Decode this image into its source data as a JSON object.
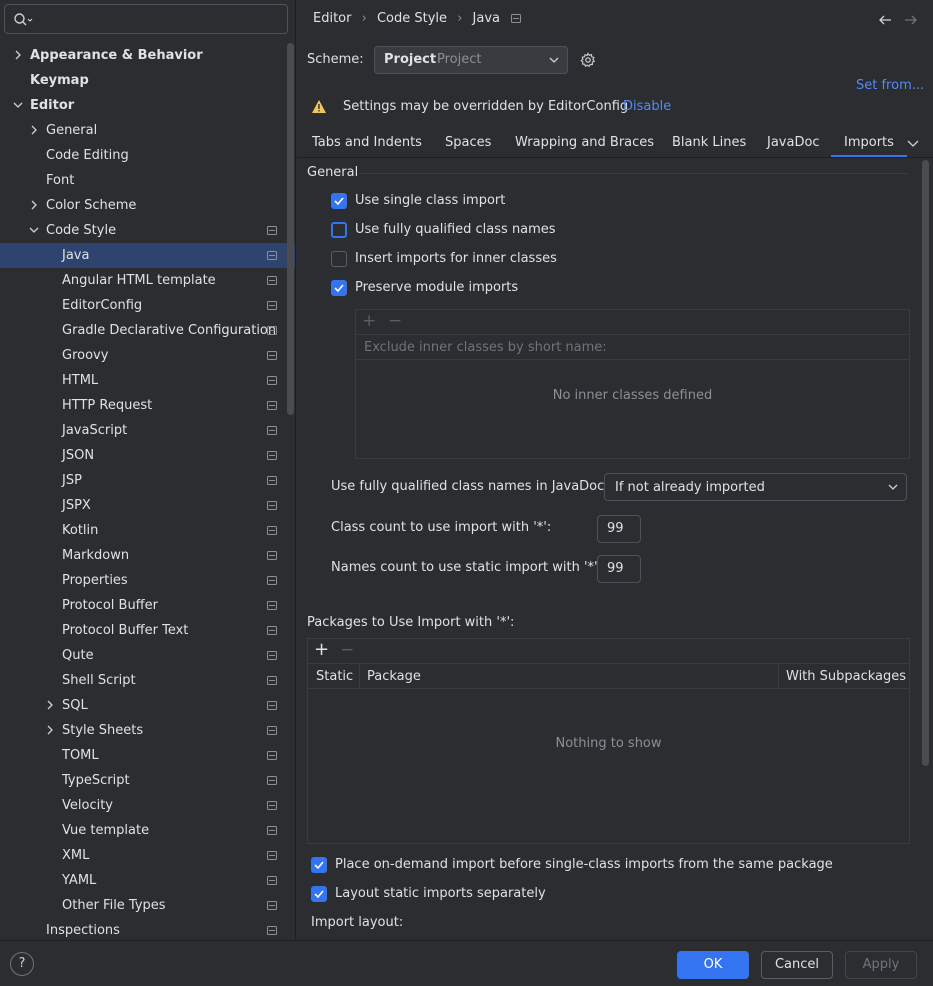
{
  "sidebar": {
    "search": {
      "value": "",
      "placeholder": ""
    },
    "items": [
      {
        "label": "Appearance & Behavior",
        "level": 0,
        "expandable": true,
        "expanded": false,
        "bold": true
      },
      {
        "label": "Keymap",
        "level": 0,
        "expandable": false,
        "bold": true
      },
      {
        "label": "Editor",
        "level": 0,
        "expandable": true,
        "expanded": true,
        "bold": true
      },
      {
        "label": "General",
        "level": 1,
        "expandable": true,
        "expanded": false
      },
      {
        "label": "Code Editing",
        "level": 1,
        "expandable": false
      },
      {
        "label": "Font",
        "level": 1,
        "expandable": false
      },
      {
        "label": "Color Scheme",
        "level": 1,
        "expandable": true,
        "expanded": false
      },
      {
        "label": "Code Style",
        "level": 1,
        "expandable": true,
        "expanded": true,
        "project": true
      },
      {
        "label": "Java",
        "level": 2,
        "selected": true,
        "project": true
      },
      {
        "label": "Angular HTML template",
        "level": 2,
        "project": true
      },
      {
        "label": "EditorConfig",
        "level": 2,
        "project": true
      },
      {
        "label": "Gradle Declarative Configuration",
        "level": 2,
        "project": true
      },
      {
        "label": "Groovy",
        "level": 2,
        "project": true
      },
      {
        "label": "HTML",
        "level": 2,
        "project": true
      },
      {
        "label": "HTTP Request",
        "level": 2,
        "project": true
      },
      {
        "label": "JavaScript",
        "level": 2,
        "project": true
      },
      {
        "label": "JSON",
        "level": 2,
        "project": true
      },
      {
        "label": "JSP",
        "level": 2,
        "project": true
      },
      {
        "label": "JSPX",
        "level": 2,
        "project": true
      },
      {
        "label": "Kotlin",
        "level": 2,
        "project": true
      },
      {
        "label": "Markdown",
        "level": 2,
        "project": true
      },
      {
        "label": "Properties",
        "level": 2,
        "project": true
      },
      {
        "label": "Protocol Buffer",
        "level": 2,
        "project": true
      },
      {
        "label": "Protocol Buffer Text",
        "level": 2,
        "project": true
      },
      {
        "label": "Qute",
        "level": 2,
        "project": true
      },
      {
        "label": "Shell Script",
        "level": 2,
        "project": true
      },
      {
        "label": "SQL",
        "level": 2,
        "expandable": true,
        "expanded": false,
        "project": true
      },
      {
        "label": "Style Sheets",
        "level": 2,
        "expandable": true,
        "expanded": false,
        "project": true
      },
      {
        "label": "TOML",
        "level": 2,
        "project": true
      },
      {
        "label": "TypeScript",
        "level": 2,
        "project": true
      },
      {
        "label": "Velocity",
        "level": 2,
        "project": true
      },
      {
        "label": "Vue template",
        "level": 2,
        "project": true
      },
      {
        "label": "XML",
        "level": 2,
        "project": true
      },
      {
        "label": "YAML",
        "level": 2,
        "project": true
      },
      {
        "label": "Other File Types",
        "level": 2,
        "project": true
      },
      {
        "label": "Inspections",
        "level": 1,
        "project": true
      }
    ]
  },
  "header": {
    "breadcrumb": [
      "Editor",
      "Code Style",
      "Java"
    ],
    "sep": "›"
  },
  "scheme": {
    "label": "Scheme:",
    "name": "Project",
    "type": "Project",
    "set_from": "Set from..."
  },
  "warning": {
    "text": "Settings may be overridden by EditorConfig",
    "action": "Disable"
  },
  "tabs": [
    {
      "label": "Tabs and Indents",
      "active": false
    },
    {
      "label": "Spaces",
      "active": false
    },
    {
      "label": "Wrapping and Braces",
      "active": false
    },
    {
      "label": "Blank Lines",
      "active": false
    },
    {
      "label": "JavaDoc",
      "active": false
    },
    {
      "label": "Imports",
      "active": true
    }
  ],
  "general": {
    "title": "General",
    "checkboxes": [
      {
        "label": "Use single class import",
        "checked": true
      },
      {
        "label": "Use fully qualified class names",
        "checked": false,
        "focused": true
      },
      {
        "label": "Insert imports for inner classes",
        "checked": false
      },
      {
        "label": "Preserve module imports",
        "checked": true
      }
    ],
    "inner_classes": {
      "add": "+",
      "remove": "−",
      "placeholder": "Exclude inner classes by short name:",
      "empty": "No inner classes defined"
    },
    "javadoc_label": "Use fully qualified class names in JavaDoc:",
    "javadoc_value": "If not already imported",
    "class_count_label": "Class count to use import with '*':",
    "class_count_value": "99",
    "names_count_label": "Names count to use static import with '*':",
    "names_count_value": "99"
  },
  "packages": {
    "title": "Packages to Use Import with '*':",
    "add": "+",
    "remove": "−",
    "columns": [
      "Static",
      "Package",
      "With Subpackages"
    ],
    "empty": "Nothing to show"
  },
  "bottom_checkboxes": [
    {
      "label": "Place on-demand import before single-class imports from the same package",
      "checked": true
    },
    {
      "label": "Layout static imports separately",
      "checked": true
    }
  ],
  "import_layout_label": "Import layout:",
  "buttons": {
    "help": "?",
    "ok": "OK",
    "cancel": "Cancel",
    "apply": "Apply"
  },
  "colors": {
    "accent": "#3574f0",
    "background": "#2b2d30",
    "selection": "#2e436e",
    "warning": "#f2c55c",
    "link": "#548af7"
  }
}
